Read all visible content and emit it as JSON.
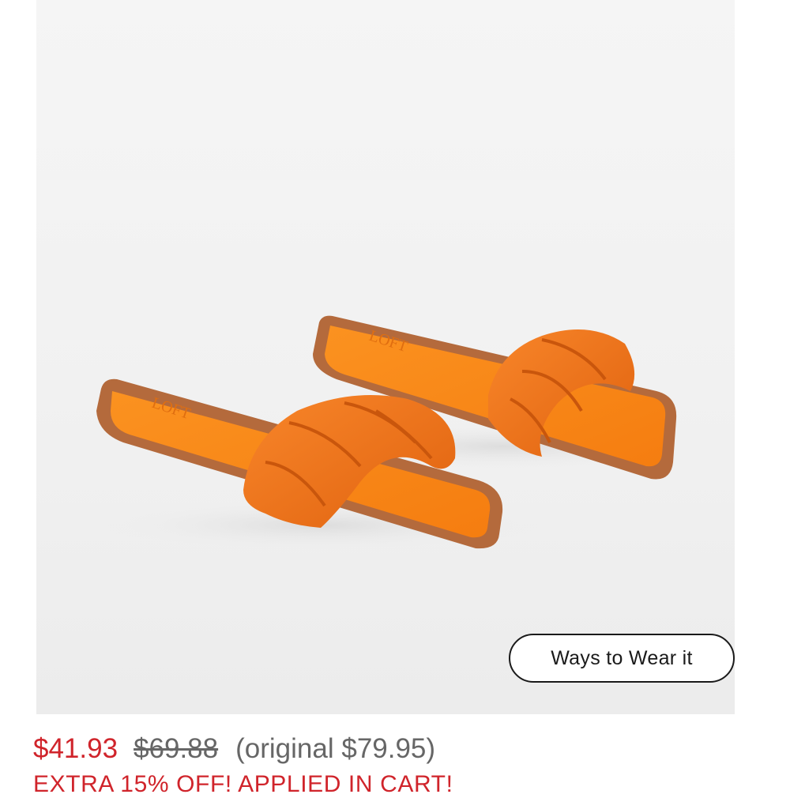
{
  "product": {
    "image": {
      "alt": "Orange braided strap slide sandals",
      "brand_mark": "LOFT",
      "colors": {
        "strap": "#f57c1f",
        "footbed": "#f98c16",
        "sole": "#b76a3a",
        "background": "#f2f2f2"
      }
    },
    "ways_to_wear_label": "Ways to Wear it",
    "pricing": {
      "sale_price": "$41.93",
      "was_price": "$69.88",
      "original_price": "(original $79.95)",
      "promo_text": "EXTRA 15% OFF! APPLIED IN CART!",
      "sale_color": "#d0242b"
    }
  }
}
